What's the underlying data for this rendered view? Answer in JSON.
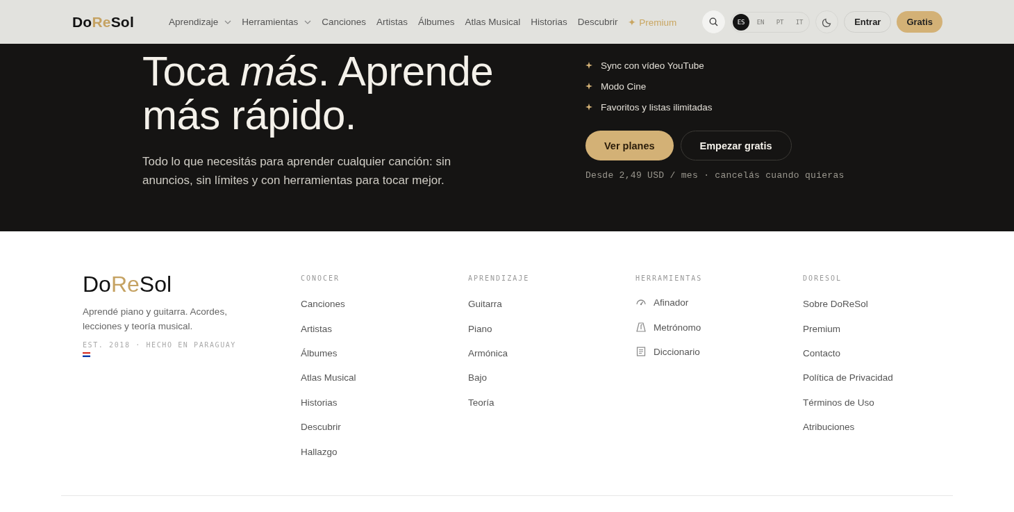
{
  "header": {
    "logo": [
      {
        "text": "Do",
        "accent": false
      },
      {
        "text": "Re",
        "accent": true
      },
      {
        "text": "Sol",
        "accent": false
      }
    ],
    "nav": [
      {
        "label": "Aprendizaje",
        "kind": "dropdown"
      },
      {
        "label": "Herramientas",
        "kind": "dropdown"
      },
      {
        "label": "Canciones",
        "kind": "link"
      },
      {
        "label": "Artistas",
        "kind": "link"
      },
      {
        "label": "Álbumes",
        "kind": "link"
      },
      {
        "label": "Atlas Musical",
        "kind": "link"
      },
      {
        "label": "Historias",
        "kind": "link"
      },
      {
        "label": "Descubrir",
        "kind": "link"
      },
      {
        "label": "✦ Premium",
        "kind": "premium"
      }
    ],
    "languages": [
      {
        "label": "ES",
        "selected": true
      },
      {
        "label": "EN",
        "selected": false
      },
      {
        "label": "PT",
        "selected": false
      },
      {
        "label": "IT",
        "selected": false
      }
    ],
    "login": "Entrar",
    "signup": "Gratis"
  },
  "hero": {
    "title_lines": [
      "Toca *más*. Aprende",
      "más rápido."
    ],
    "subtitle": "Todo lo que necesitás para aprender cualquier canción: sin anuncios, sin límites y con herramientas para tocar mejor.",
    "features": [
      "Sync con vídeo YouTube",
      "Modo Cine",
      "Favoritos y listas ilimitadas"
    ],
    "primary_button": "Ver planes",
    "secondary_button": "Empezar gratis",
    "price_note": "Desde 2,49 USD / mes · cancelás cuando quieras"
  },
  "footer": {
    "logo": [
      {
        "text": "Do",
        "accent": false
      },
      {
        "text": "Re",
        "accent": true
      },
      {
        "text": "Sol",
        "accent": false
      }
    ],
    "tagline": "Aprendé piano y guitarra. Acordes, lecciones y teoría musical.",
    "established": "EST. 2018 · HECHO EN PARAGUAY",
    "columns": [
      {
        "heading": "CONOCER",
        "links": [
          "Canciones",
          "Artistas",
          "Álbumes",
          "Atlas Musical",
          "Historias",
          "Descubrir",
          "Hallazgo"
        ]
      },
      {
        "heading": "APRENDIZAJE",
        "links": [
          "Guitarra",
          "Piano",
          "Armónica",
          "Bajo",
          "Teoría"
        ]
      },
      {
        "heading": "HERRAMIENTAS",
        "kind": "icons",
        "links": [
          "Afinador",
          "Metrónomo",
          "Diccionario"
        ]
      },
      {
        "heading": "DORESOL",
        "links": [
          "Sobre DoReSol",
          "Premium",
          "Contacto",
          "Política de Privacidad",
          "Términos de Uso",
          "Atribuciones"
        ]
      }
    ]
  }
}
